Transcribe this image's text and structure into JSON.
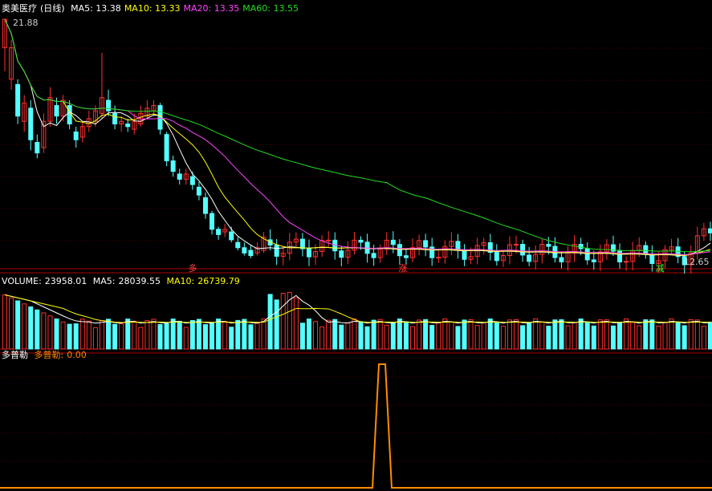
{
  "price_panel": {
    "stock_name": "奥美医疗",
    "period": "(日线)",
    "ma_legend": [
      {
        "label": "MA5:",
        "value": "13.38",
        "color": "#ffffff"
      },
      {
        "label": "MA10:",
        "value": "13.33",
        "color": "#ffff00"
      },
      {
        "label": "MA20:",
        "value": "13.35",
        "color": "#ff44ff"
      },
      {
        "label": "MA60:",
        "value": "13.55",
        "color": "#22dd22"
      }
    ],
    "high_label": "21.88",
    "low_label": "12.65",
    "signals": [
      {
        "text": "多",
        "color": "#ff4444",
        "index": 19
      },
      {
        "text": "涨",
        "color": "#ff4444",
        "index": 41
      },
      {
        "text": "减",
        "color": "#33ff33",
        "index": 67
      }
    ]
  },
  "volume_panel": {
    "title": "VOLUME:",
    "volume_value": "23958.01",
    "ma5_label": "MA5:",
    "ma5_value": "28039.55",
    "ma10_label": "MA10:",
    "ma10_value": "26739.79"
  },
  "indicator_panel": {
    "name": "多普勒",
    "series_label": "多普勒:",
    "series_value": "0.00"
  },
  "colors": {
    "up": "#ff3030",
    "down": "#54ffff",
    "axis": "#b00000",
    "grid": "#5a0000",
    "ma5": "#ffffff",
    "ma10": "#ffff00",
    "ma20": "#ff44ff",
    "ma60": "#22dd22",
    "indicator_line": "#ff8c00"
  },
  "chart_data": {
    "type": "candlestick",
    "price_range": [
      12.65,
      21.88
    ],
    "candles": [
      [
        20.8,
        21.88,
        21.88,
        19.9
      ],
      [
        19.6,
        20.8,
        21.1,
        19.2
      ],
      [
        19.4,
        18.2,
        19.6,
        17.9
      ],
      [
        18.0,
        18.7,
        19.0,
        17.6
      ],
      [
        18.5,
        17.3,
        18.8,
        16.9
      ],
      [
        17.2,
        16.8,
        17.5,
        16.6
      ],
      [
        17.0,
        18.0,
        18.3,
        16.8
      ],
      [
        18.0,
        18.9,
        19.3,
        17.8
      ],
      [
        18.6,
        18.2,
        18.9,
        17.9
      ],
      [
        18.2,
        18.8,
        19.0,
        18.0
      ],
      [
        18.6,
        17.9,
        18.8,
        17.7
      ],
      [
        17.6,
        17.3,
        17.8,
        17.0
      ],
      [
        17.4,
        17.8,
        18.0,
        17.2
      ],
      [
        17.8,
        18.1,
        18.4,
        17.6
      ],
      [
        18.0,
        18.4,
        18.6,
        17.8
      ],
      [
        18.3,
        18.9,
        20.6,
        18.1
      ],
      [
        18.8,
        18.4,
        19.2,
        18.2
      ],
      [
        18.3,
        17.9,
        18.6,
        17.7
      ],
      [
        17.9,
        18.0,
        18.2,
        17.6
      ],
      [
        17.9,
        17.8,
        18.1,
        17.6
      ],
      [
        17.7,
        18.0,
        18.3,
        17.5
      ],
      [
        17.9,
        18.3,
        18.6,
        17.8
      ],
      [
        18.2,
        18.5,
        18.8,
        18.1
      ],
      [
        18.4,
        18.6,
        18.8,
        18.2
      ],
      [
        18.6,
        17.7,
        18.7,
        17.5
      ],
      [
        17.5,
        16.5,
        17.6,
        16.3
      ],
      [
        16.5,
        16.1,
        16.7,
        15.9
      ],
      [
        16.0,
        15.8,
        16.2,
        15.6
      ],
      [
        15.8,
        16.0,
        16.2,
        15.6
      ],
      [
        15.9,
        15.6,
        16.1,
        15.4
      ],
      [
        15.5,
        15.2,
        15.7,
        15.0
      ],
      [
        15.1,
        14.5,
        15.3,
        14.3
      ],
      [
        14.5,
        13.9,
        14.6,
        13.7
      ],
      [
        13.9,
        13.7,
        14.0,
        13.5
      ],
      [
        13.8,
        13.9,
        14.1,
        13.6
      ],
      [
        13.8,
        13.5,
        14.0,
        13.4
      ],
      [
        13.4,
        13.2,
        13.6,
        13.1
      ],
      [
        13.2,
        13.0,
        13.4,
        12.9
      ],
      [
        13.1,
        12.9,
        13.3,
        12.8
      ],
      [
        13.0,
        13.2,
        13.4,
        12.9
      ],
      [
        13.1,
        13.6,
        13.8,
        13.0
      ],
      [
        13.5,
        13.3,
        13.9,
        13.1
      ]
    ],
    "volume": [],
    "indicator": {
      "peak_index": 36,
      "peak_value": 1.0
    }
  }
}
